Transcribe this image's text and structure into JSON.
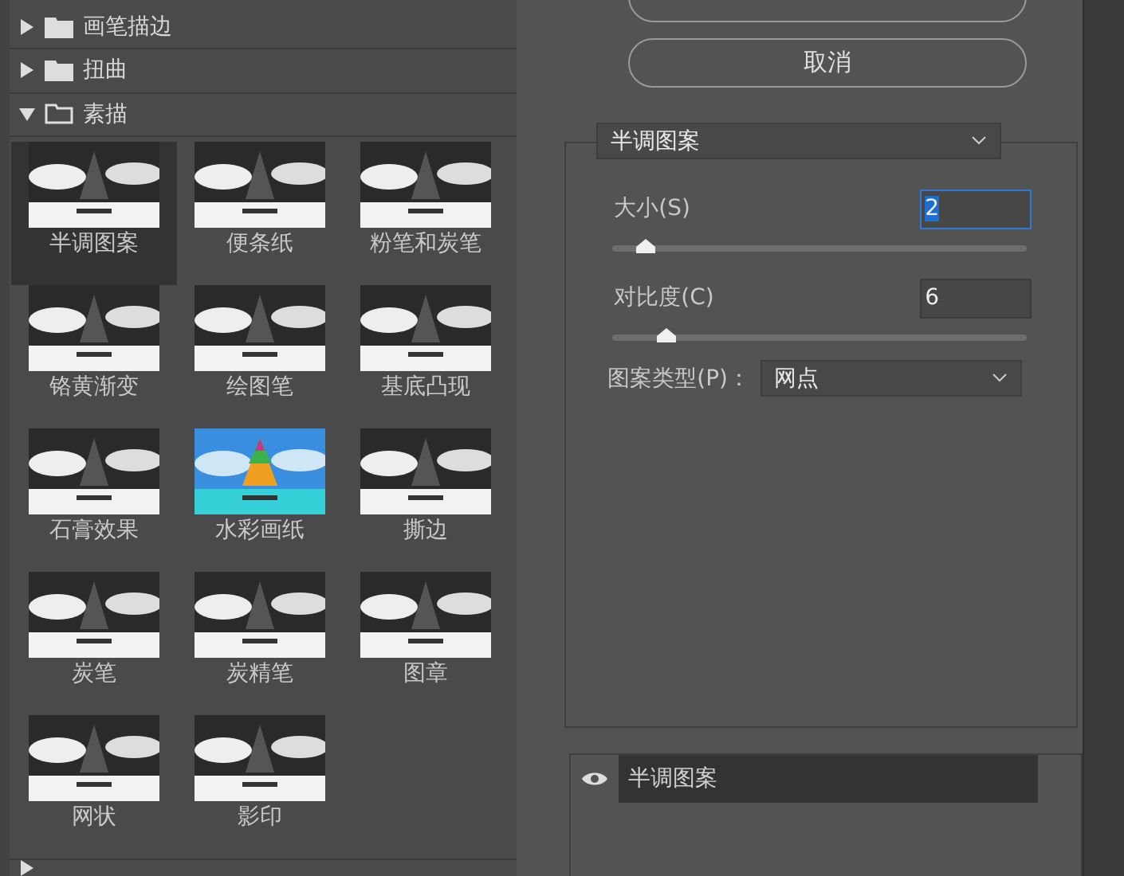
{
  "filter_groups": [
    {
      "label": "画笔描边",
      "expanded": false
    },
    {
      "label": "扭曲",
      "expanded": false
    },
    {
      "label": "素描",
      "expanded": true
    }
  ],
  "filters": [
    {
      "label": "半调图案",
      "selected": true,
      "kind": "mono"
    },
    {
      "label": "便条纸",
      "selected": false,
      "kind": "mono"
    },
    {
      "label": "粉笔和炭笔",
      "selected": false,
      "kind": "mono"
    },
    {
      "label": "铬黄渐变",
      "selected": false,
      "kind": "mono"
    },
    {
      "label": "绘图笔",
      "selected": false,
      "kind": "mono"
    },
    {
      "label": "基底凸现",
      "selected": false,
      "kind": "mono"
    },
    {
      "label": "石膏效果",
      "selected": false,
      "kind": "mono"
    },
    {
      "label": "水彩画纸",
      "selected": false,
      "kind": "color"
    },
    {
      "label": "撕边",
      "selected": false,
      "kind": "mono"
    },
    {
      "label": "炭笔",
      "selected": false,
      "kind": "mono"
    },
    {
      "label": "炭精笔",
      "selected": false,
      "kind": "mono"
    },
    {
      "label": "图章",
      "selected": false,
      "kind": "mono"
    },
    {
      "label": "网状",
      "selected": false,
      "kind": "mono"
    },
    {
      "label": "影印",
      "selected": false,
      "kind": "mono"
    }
  ],
  "buttons": {
    "cancel": "取消"
  },
  "settings": {
    "filter_select": "半调图案",
    "params": [
      {
        "label": "大小(S)",
        "value": "2",
        "focused": true,
        "level": 0.08
      },
      {
        "label": "对比度(C)",
        "value": "6",
        "focused": false,
        "level": 0.13
      }
    ],
    "pattern_type": {
      "label": "图案类型(P)：",
      "value": "网点"
    }
  },
  "layers": [
    {
      "label": "半调图案",
      "visible": true
    }
  ]
}
